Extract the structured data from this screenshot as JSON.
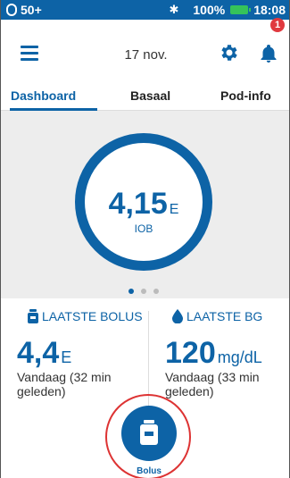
{
  "status_bar": {
    "left_text": "50+",
    "battery_percent_text": "100%",
    "time": "18:08"
  },
  "header": {
    "date": "17 nov.",
    "notification_count": "1"
  },
  "tabs": [
    {
      "label": "Dashboard",
      "active": true
    },
    {
      "label": "Basaal",
      "active": false
    },
    {
      "label": "Pod-info",
      "active": false
    }
  ],
  "iob": {
    "value": "4,15",
    "unit": "E",
    "label": "IOB"
  },
  "pager": {
    "pages": 3,
    "current": 1
  },
  "last_bolus": {
    "title": "LAATSTE BOLUS",
    "value": "4,4",
    "unit": "E",
    "detail": "Vandaag (32 min geleden)"
  },
  "last_bg": {
    "title": "LAATSTE BG",
    "value": "120",
    "unit": "mg/dL",
    "detail": "Vandaag (33 min geleden)"
  },
  "bolus_button": {
    "label": "Bolus"
  },
  "colors": {
    "primary": "#0d63a6",
    "panel_bg": "#ededed",
    "badge": "#e0393f",
    "battery": "#35c35a",
    "highlight": "#dd3333"
  }
}
